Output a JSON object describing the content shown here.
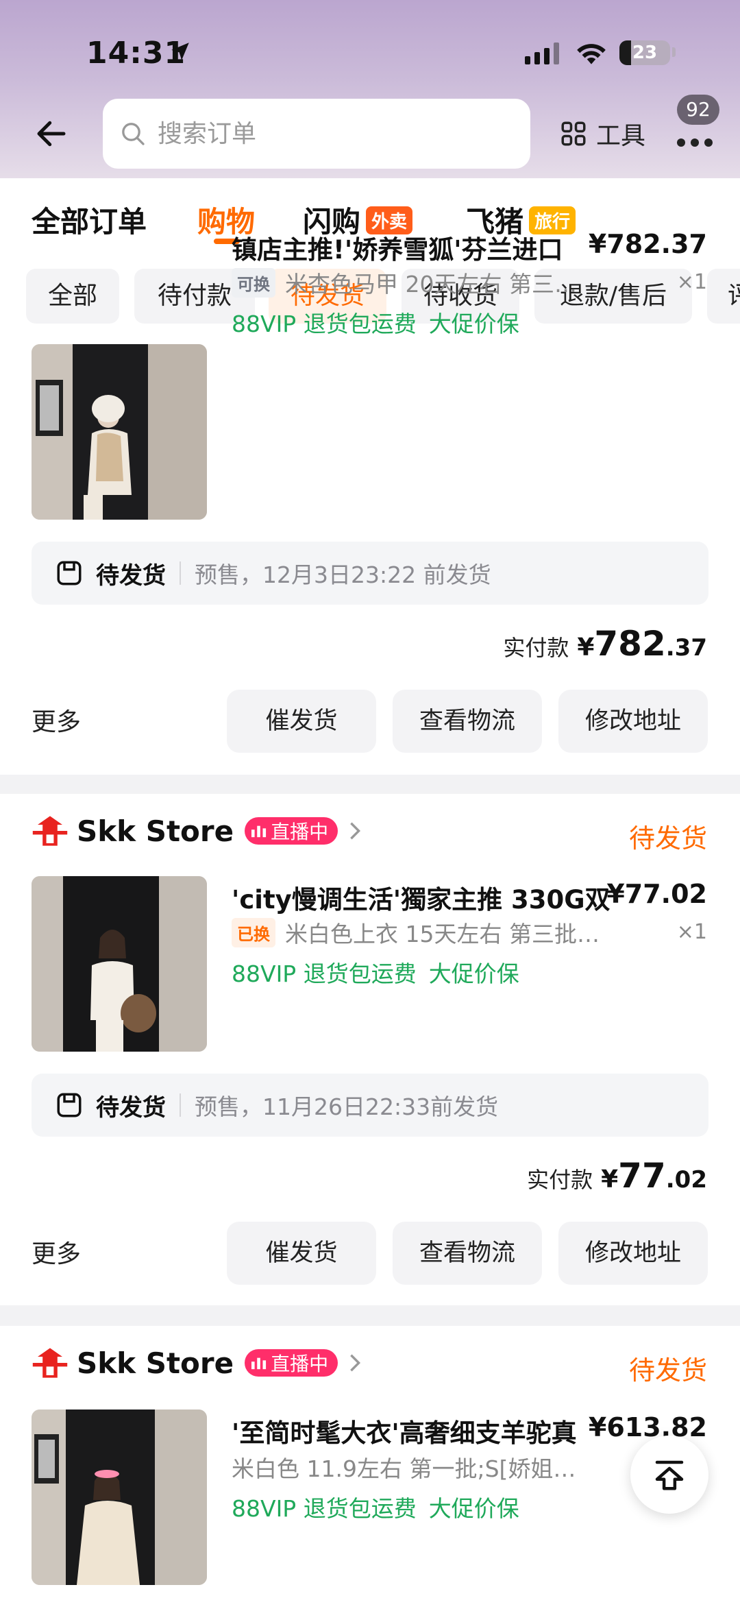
{
  "status_bar": {
    "time": "14:31",
    "battery": "23",
    "battery_level": 0.23
  },
  "header": {
    "search_placeholder": "搜索订单",
    "tools_label": "工具",
    "notification_count": "92"
  },
  "tabs": [
    {
      "label": "全部订单"
    },
    {
      "label": "购物",
      "active": true
    },
    {
      "label": "闪购",
      "tag": "外卖"
    },
    {
      "label": "飞猪",
      "tag": "旅行"
    }
  ],
  "filters": [
    {
      "label": "全部"
    },
    {
      "label": "待付款"
    },
    {
      "label": "待发货",
      "active": true
    },
    {
      "label": "待收货"
    },
    {
      "label": "退款/售后"
    },
    {
      "label": "评"
    }
  ],
  "orders": [
    {
      "product_title": "镇店主推!'娇养雪狐'芬兰进口",
      "price": "¥782.37",
      "spec_tag": "可换",
      "spec": "米杏色马甲 20天左右 第三…",
      "qty": "×1",
      "promos": [
        "88VIP 退货包运费",
        "大促价保"
      ],
      "ship_status": "待发货",
      "ship_info": "预售，12月3日23:22 前发货",
      "paid_label": "实付款",
      "paid_yen": "¥",
      "paid_int": "782",
      "paid_dec": ".37",
      "more": "更多",
      "actions": [
        "催发货",
        "查看物流",
        "修改地址"
      ]
    },
    {
      "shop_name": "Skk Store",
      "live": "直播中",
      "status": "待发货",
      "product_title": "'city慢调生活'獨家主推 330G双",
      "price": "¥77.02",
      "spec_tag": "已换",
      "spec": "米白色上衣 15天左右 第三批…",
      "qty": "×1",
      "promos": [
        "88VIP 退货包运费",
        "大促价保"
      ],
      "ship_status": "待发货",
      "ship_info": "预售，11月26日22:33前发货",
      "paid_label": "实付款",
      "paid_yen": "¥",
      "paid_int": "77",
      "paid_dec": ".02",
      "more": "更多",
      "actions": [
        "催发货",
        "查看物流",
        "修改地址"
      ]
    },
    {
      "shop_name": "Skk Store",
      "live": "直播中",
      "status": "待发货",
      "product_title": "'至简时髦大衣'高奢细支羊驼真",
      "price": "¥613.82",
      "spec": "米白色 11.9左右 第一批;S[娇姐…",
      "promos": [
        "88VIP 退货包运费",
        "大促价保"
      ]
    }
  ],
  "icons": {
    "back": "arrow-left-icon",
    "search": "search-icon",
    "tools": "grid-icon",
    "more": "more-dots-icon",
    "ship": "package-icon",
    "shop": "tmall-shop-icon",
    "to_top": "back-to-top-icon"
  },
  "colors": {
    "accent": "#ff6a00",
    "promo_green": "#1fa95a",
    "live_pink": "#ff2e6a"
  }
}
